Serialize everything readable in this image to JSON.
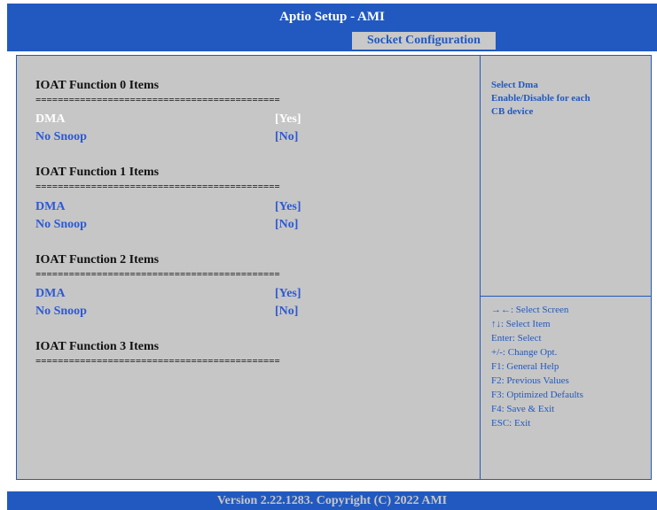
{
  "header": {
    "title": "Aptio Setup  - AMI",
    "active_tab": "Socket Configuration"
  },
  "sections": [
    {
      "title": "IOAT Function 0 Items",
      "separator": "============================================",
      "items": [
        {
          "label": "DMA",
          "value": "[Yes]",
          "selected": true
        },
        {
          "label": "No Snoop",
          "value": "[No]",
          "selected": false
        }
      ]
    },
    {
      "title": "IOAT Function 1 Items",
      "separator": "============================================",
      "items": [
        {
          "label": "DMA",
          "value": "[Yes]",
          "selected": false
        },
        {
          "label": "No Snoop",
          "value": "[No]",
          "selected": false
        }
      ]
    },
    {
      "title": "IOAT Function 2 Items",
      "separator": "============================================",
      "items": [
        {
          "label": "DMA",
          "value": "[Yes]",
          "selected": false
        },
        {
          "label": "No Snoop",
          "value": "[No]",
          "selected": false
        }
      ]
    },
    {
      "title": "IOAT Function 3 Items",
      "separator": "============================================",
      "items": []
    }
  ],
  "help": {
    "line1": "Select Dma",
    "line2": "Enable/Disable for each",
    "line3": "CB device"
  },
  "keys": [
    "→←: Select Screen",
    "↑↓: Select Item",
    "Enter: Select",
    "+/-: Change Opt.",
    "F1: General Help",
    "F2: Previous Values",
    "F3: Optimized Defaults",
    "F4: Save & Exit",
    "ESC: Exit"
  ],
  "footer": {
    "version": "Version 2.22.1283. Copyright (C) 2022 AMI"
  },
  "colors": {
    "accent_blue": "#2159c0",
    "panel_gray": "#c6c6c6",
    "selected_text": "#ffffff",
    "item_text": "#2d5ad4"
  }
}
